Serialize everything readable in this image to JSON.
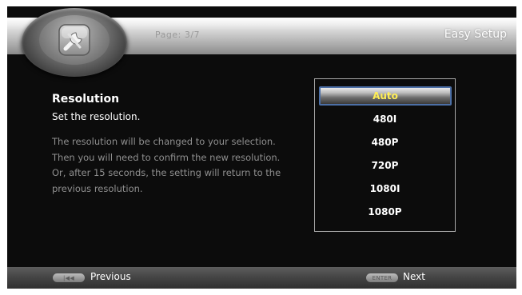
{
  "header": {
    "page_indicator": "Page: 3/7",
    "title": "Easy Setup",
    "logo_icon": "settings-wrench-icon"
  },
  "content": {
    "title": "Resolution",
    "subtitle": "Set the resolution.",
    "description": "The resolution will be changed to your selection.  Then you will need to confirm the new resolution.  Or, after 15 seconds, the setting will return to the previous resolution."
  },
  "options": {
    "selected": "Auto",
    "items": [
      "Auto",
      "480I",
      "480P",
      "720P",
      "1080I",
      "1080P"
    ]
  },
  "footer": {
    "previous_key": "|◀◀",
    "previous_label": "Previous",
    "next_key": "ENTER",
    "next_label": "Next"
  },
  "colors": {
    "selected_text": "#ffee55",
    "highlight_border": "#4c6fa6",
    "background": "#0c0c0c"
  }
}
